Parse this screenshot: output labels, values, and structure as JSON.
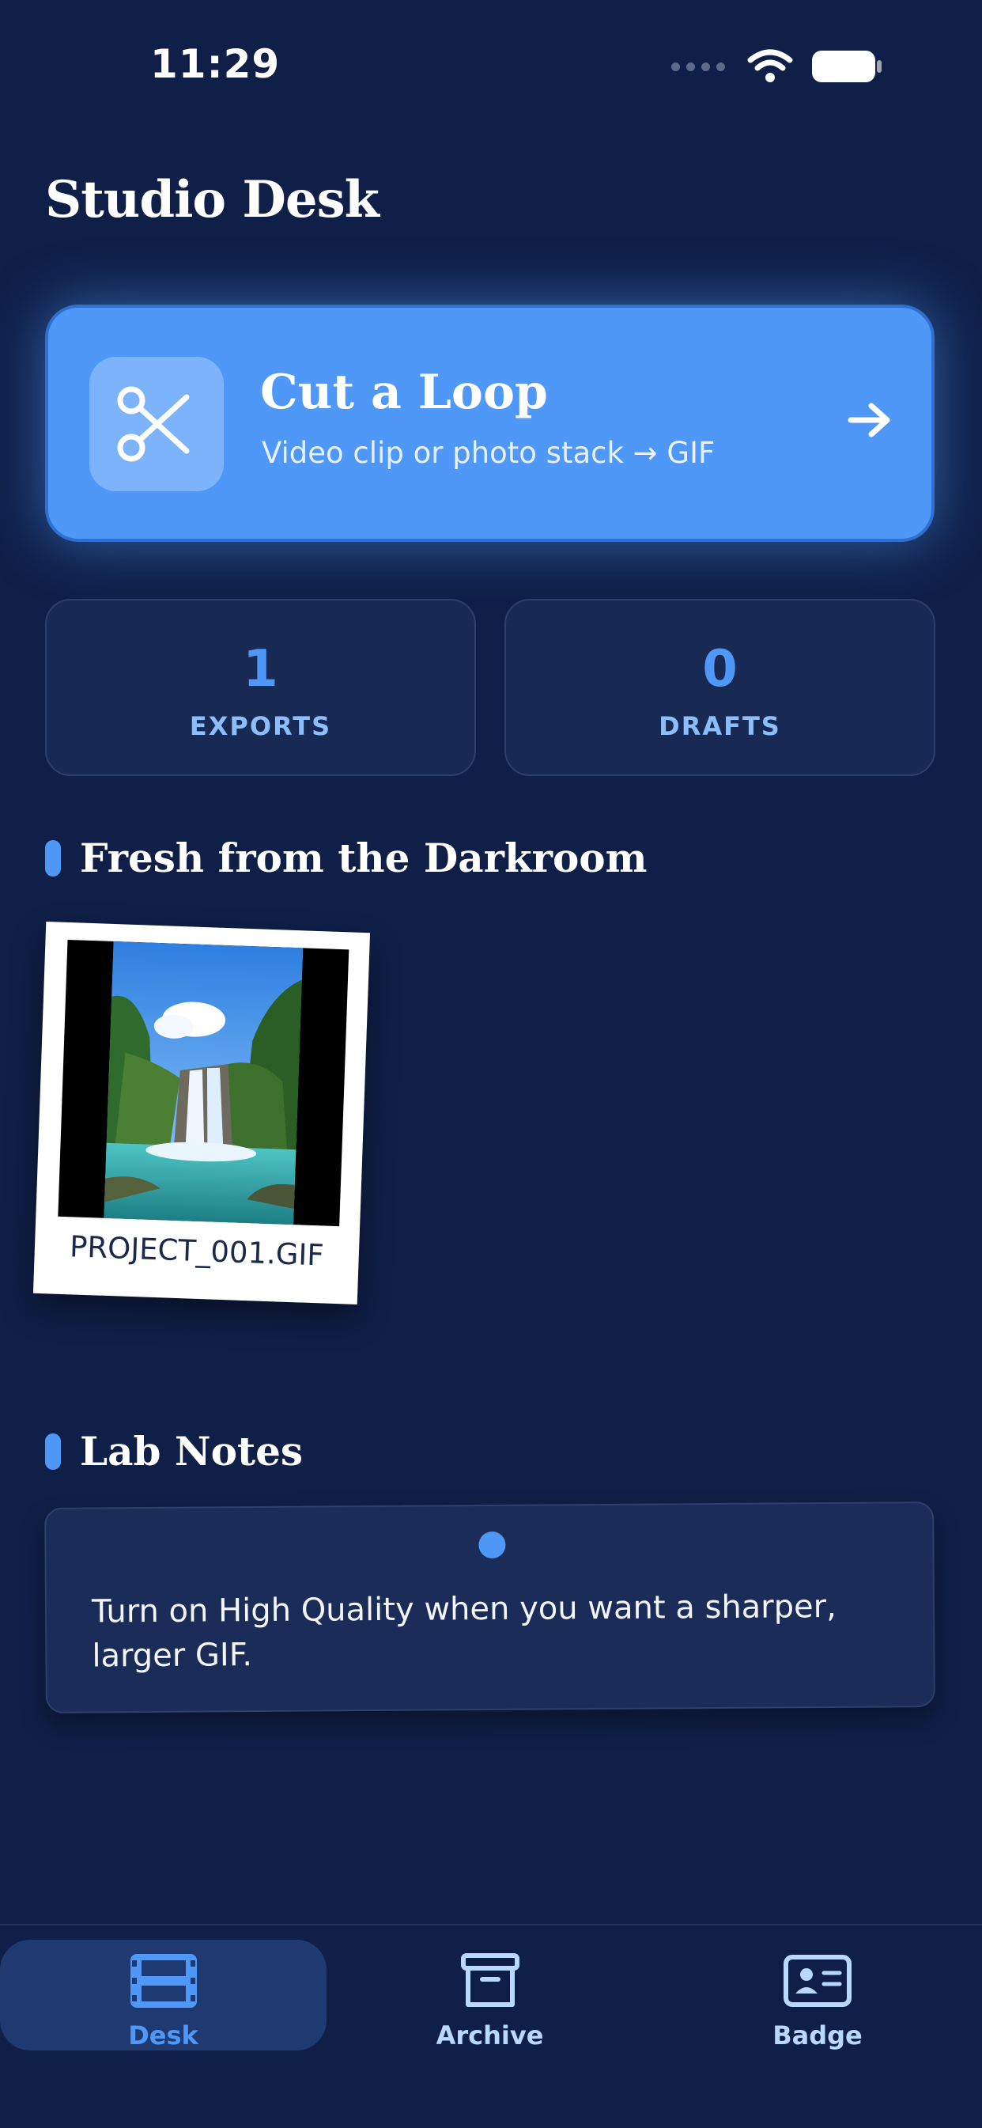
{
  "status_bar": {
    "time": "11:29"
  },
  "header": {
    "title": "Studio Desk"
  },
  "cta": {
    "title": "Cut a Loop",
    "subtitle": "Video clip or photo stack → GIF",
    "icon": "scissors-icon"
  },
  "stats": [
    {
      "value": "1",
      "label": "EXPORTS"
    },
    {
      "value": "0",
      "label": "DRAFTS"
    }
  ],
  "recent": {
    "title": "Fresh from the Darkroom",
    "items": [
      {
        "caption": "PROJECT_001.GIF"
      }
    ]
  },
  "notes": {
    "title": "Lab Notes",
    "text": "Turn on High Quality when you want a sharper, larger GIF."
  },
  "tabs": [
    {
      "label": "Desk",
      "icon": "film-icon",
      "active": true
    },
    {
      "label": "Archive",
      "icon": "archive-box-icon",
      "active": false
    },
    {
      "label": "Badge",
      "icon": "id-badge-icon",
      "active": false
    }
  ],
  "colors": {
    "background": "#0f1f47",
    "accent": "#4f98f8",
    "card": "#182a54"
  }
}
